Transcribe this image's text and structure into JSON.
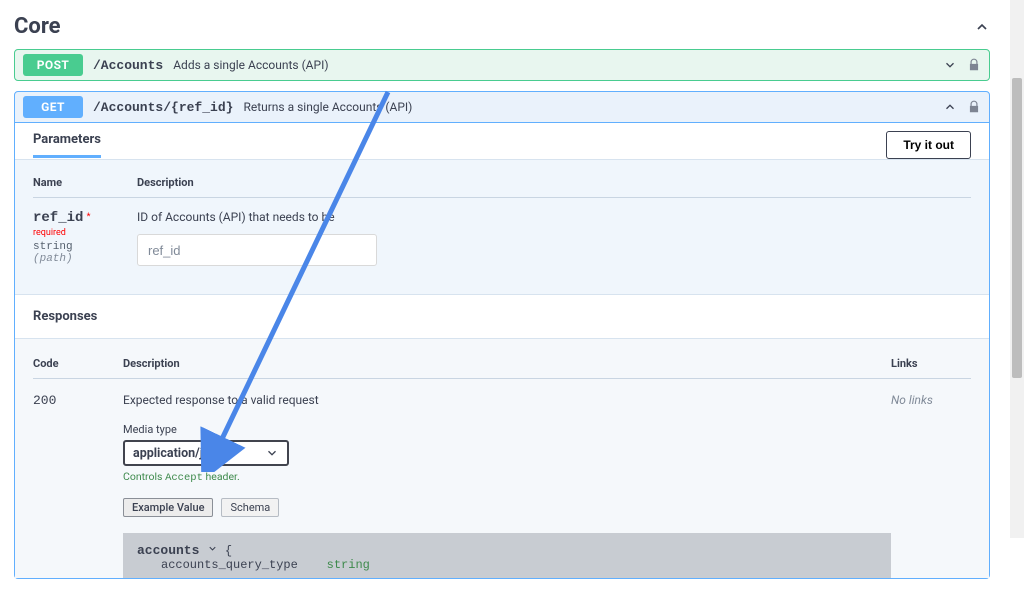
{
  "section": {
    "title": "Core"
  },
  "operations": {
    "post": {
      "method": "POST",
      "path": "/Accounts",
      "description": "Adds a single Accounts (API)"
    },
    "get": {
      "method": "GET",
      "path": "/Accounts/{ref_id}",
      "description": "Returns a single Accounts (API)"
    }
  },
  "parameters": {
    "heading": "Parameters",
    "try_label": "Try it out",
    "head_name": "Name",
    "head_desc": "Description",
    "ref_id": {
      "name": "ref_id",
      "required_marker": "* required",
      "type": "string",
      "in": "(path)",
      "desc": "ID of Accounts (API) that needs to be",
      "placeholder": "ref_id"
    }
  },
  "responses": {
    "heading": "Responses",
    "head_code": "Code",
    "head_desc": "Description",
    "head_links": "Links",
    "row": {
      "code": "200",
      "desc": "Expected response to a valid request",
      "links": "No links"
    },
    "media_type_label": "Media type",
    "media_type_value": "application/json",
    "controls_prefix": "Controls ",
    "controls_mono": "Accept",
    "controls_suffix": " header.",
    "tab_example": "Example Value",
    "tab_schema": "Schema",
    "schema": {
      "root_name": "accounts",
      "brace": "{",
      "field1_key": "accounts_query_type",
      "field1_type": "string"
    }
  }
}
